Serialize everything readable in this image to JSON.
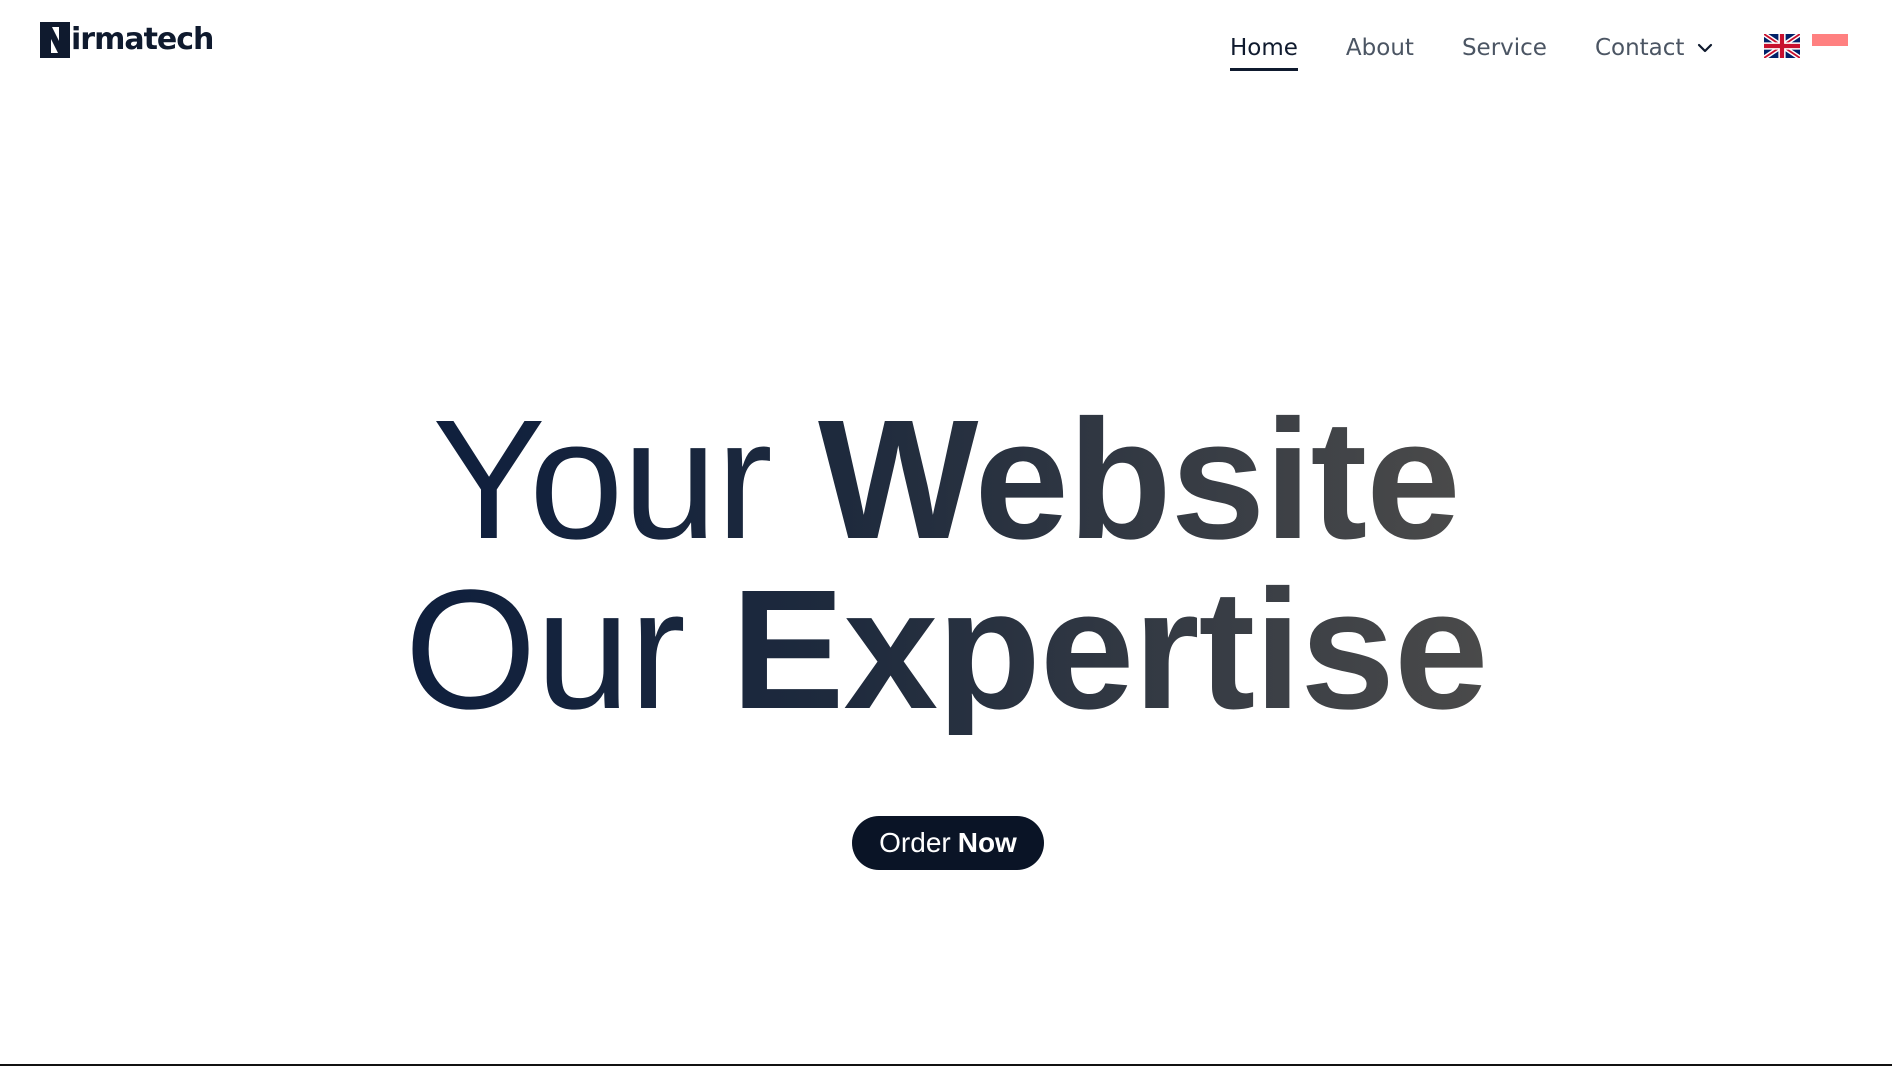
{
  "header": {
    "logo_initial": "N",
    "logo_text": "irmatech",
    "nav": [
      {
        "label": "Home",
        "active": true
      },
      {
        "label": "About",
        "active": false
      },
      {
        "label": "Service",
        "active": false
      },
      {
        "label": "Contact",
        "active": false,
        "has_dropdown": true
      }
    ],
    "languages": [
      {
        "flag": "uk-flag-icon"
      },
      {
        "flag": "indonesia-flag-icon"
      }
    ]
  },
  "hero": {
    "line1_light": "Your",
    "line1_bold": "Website",
    "line2_light": "Our",
    "line2_bold": "Expertise"
  },
  "cta": {
    "light": "Order",
    "bold": "Now"
  },
  "colors": {
    "text_dark": "#0f1a2e",
    "nav_muted": "#4b5563",
    "button_bg": "#0a1426",
    "flag_id": "#ff8080"
  }
}
